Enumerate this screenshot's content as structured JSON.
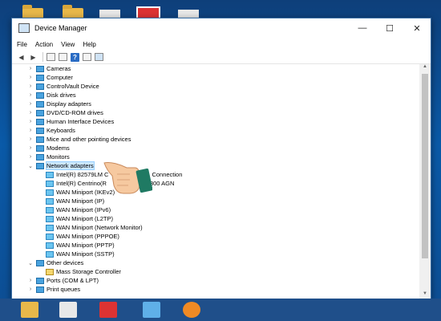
{
  "window": {
    "title": "Device Manager",
    "minimize": "—",
    "maximize": "☐",
    "close": "✕"
  },
  "menu": [
    "File",
    "Action",
    "View",
    "Help"
  ],
  "tree": [
    {
      "label": "Cameras",
      "level": 1,
      "expand": "collapsed"
    },
    {
      "label": "Computer",
      "level": 1,
      "expand": "collapsed"
    },
    {
      "label": "ControlVault Device",
      "level": 1,
      "expand": "collapsed"
    },
    {
      "label": "Disk drives",
      "level": 1,
      "expand": "collapsed"
    },
    {
      "label": "Display adapters",
      "level": 1,
      "expand": "collapsed"
    },
    {
      "label": "DVD/CD-ROM drives",
      "level": 1,
      "expand": "collapsed"
    },
    {
      "label": "Human Interface Devices",
      "level": 1,
      "expand": "collapsed"
    },
    {
      "label": "Keyboards",
      "level": 1,
      "expand": "collapsed"
    },
    {
      "label": "Mice and other pointing devices",
      "level": 1,
      "expand": "collapsed"
    },
    {
      "label": "Modems",
      "level": 1,
      "expand": "collapsed"
    },
    {
      "label": "Monitors",
      "level": 1,
      "expand": "collapsed"
    },
    {
      "label": "Network adapters",
      "level": 1,
      "expand": "expanded",
      "selected": true
    },
    {
      "label": "Intel(R) 82579LM C",
      "suffix": "Connection",
      "level": 2
    },
    {
      "label": "Intel(R) Centrino(R",
      "suffix": "300 AGN",
      "level": 2
    },
    {
      "label": "WAN Miniport (IKEv2)",
      "level": 2
    },
    {
      "label": "WAN Miniport (IP)",
      "level": 2
    },
    {
      "label": "WAN Miniport (IPv6)",
      "level": 2
    },
    {
      "label": "WAN Miniport (L2TP)",
      "level": 2
    },
    {
      "label": "WAN Miniport (Network Monitor)",
      "level": 2
    },
    {
      "label": "WAN Miniport (PPPOE)",
      "level": 2
    },
    {
      "label": "WAN Miniport (PPTP)",
      "level": 2
    },
    {
      "label": "WAN Miniport (SSTP)",
      "level": 2
    },
    {
      "label": "Other devices",
      "level": 1,
      "expand": "expanded"
    },
    {
      "label": "Mass Storage Controller",
      "level": 2,
      "warn": true
    },
    {
      "label": "Ports (COM & LPT)",
      "level": 1,
      "expand": "collapsed"
    },
    {
      "label": "Print queues",
      "level": 1,
      "expand": "collapsed"
    }
  ]
}
